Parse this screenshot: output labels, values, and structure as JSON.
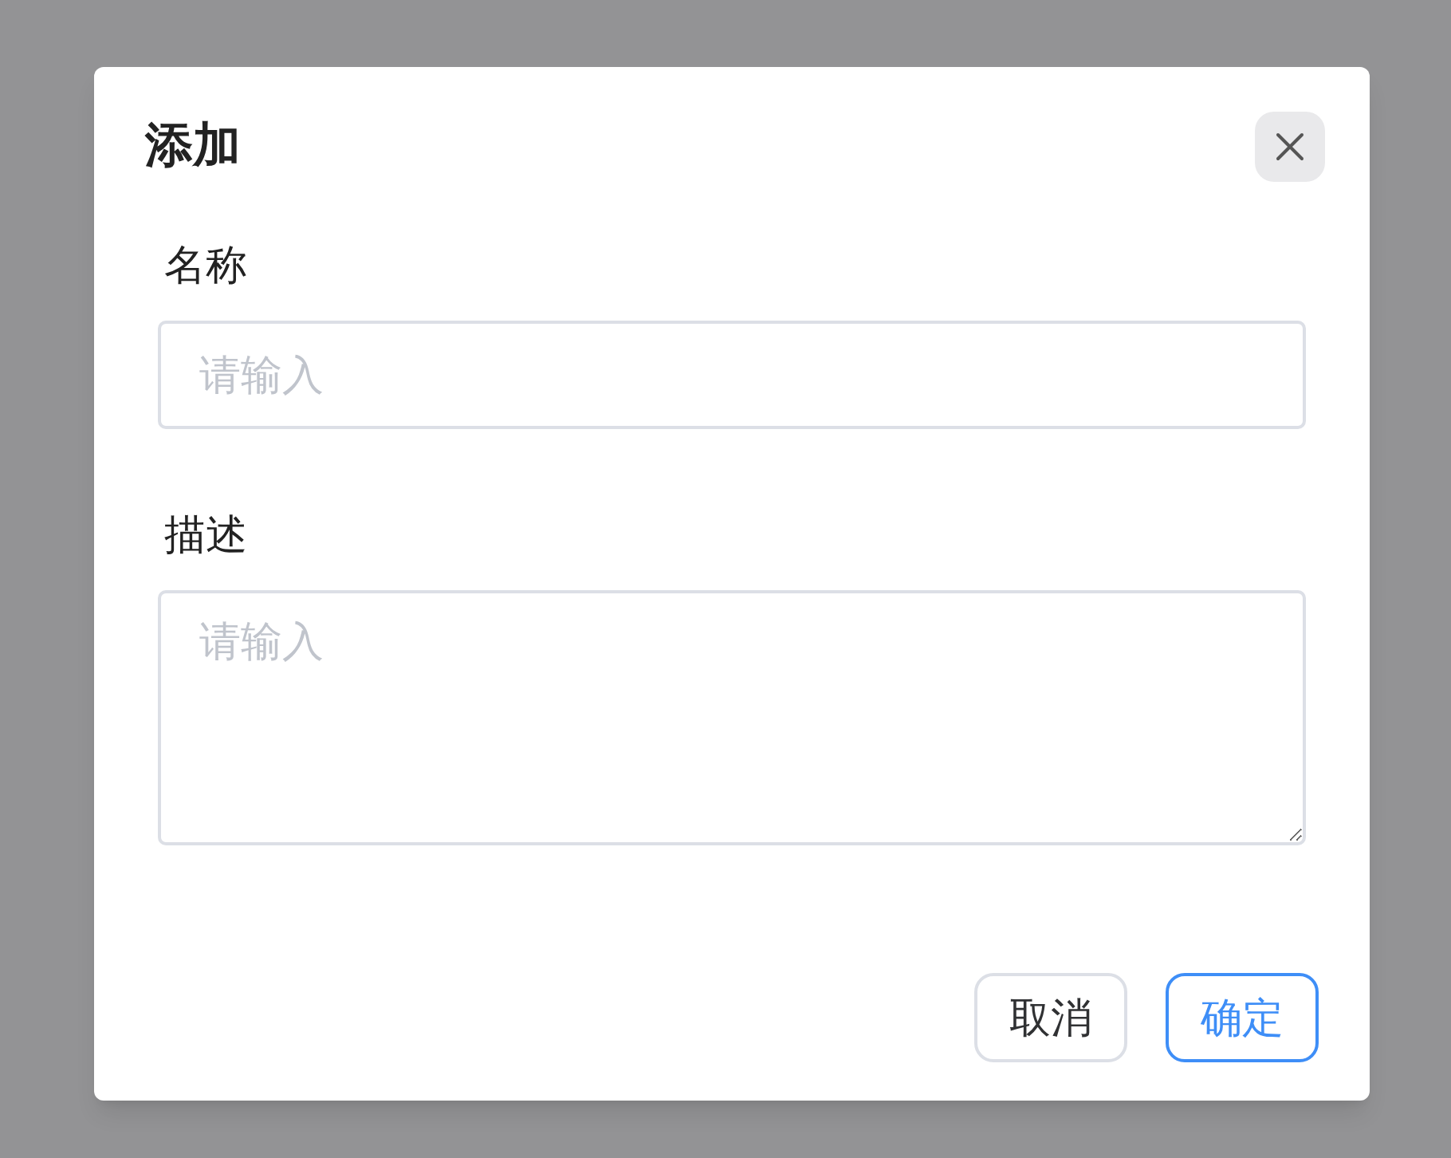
{
  "dialog": {
    "title": "添加",
    "fields": [
      {
        "kind": "input",
        "label": "名称",
        "placeholder": "请输入"
      },
      {
        "kind": "textarea",
        "label": "描述",
        "placeholder": "请输入"
      }
    ],
    "buttons": [
      {
        "kind": "default",
        "label": "取消"
      },
      {
        "kind": "primary",
        "label": "确定"
      }
    ]
  }
}
